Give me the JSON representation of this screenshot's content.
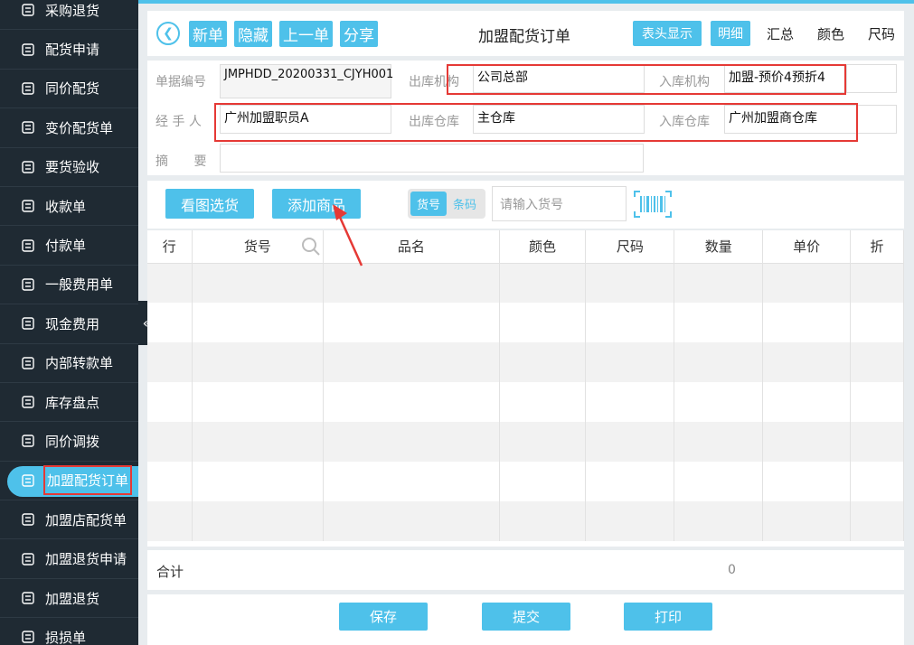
{
  "sidebar": {
    "items": [
      {
        "label": "采购退货",
        "icon": "return-box-icon"
      },
      {
        "label": "配货申请",
        "icon": "gear-house-icon"
      },
      {
        "label": "同价配货",
        "icon": "list-icon"
      },
      {
        "label": "变价配货单",
        "icon": "clipboard-icon"
      },
      {
        "label": "要货验收",
        "icon": "magnify-check-icon"
      },
      {
        "label": "收款单",
        "icon": "yen-box-icon"
      },
      {
        "label": "付款单",
        "icon": "pay-icon"
      },
      {
        "label": "一般费用单",
        "icon": "yen-circle-icon"
      },
      {
        "label": "现金费用",
        "icon": "money-bag-icon"
      },
      {
        "label": "内部转款单",
        "icon": "transfer-icon"
      },
      {
        "label": "库存盘点",
        "icon": "cycle-icon"
      },
      {
        "label": "同价调拨",
        "icon": "cart-icon"
      },
      {
        "label": "加盟配货订单",
        "icon": "order-doc-icon",
        "active": true
      },
      {
        "label": "加盟店配货单",
        "icon": "doc-list-icon"
      },
      {
        "label": "加盟退货申请",
        "icon": "doc-return-icon"
      },
      {
        "label": "加盟退货",
        "icon": "home-return-icon"
      },
      {
        "label": "损损单",
        "icon": "damage-icon"
      }
    ]
  },
  "toolbar": {
    "new_label": "新单",
    "hide_label": "隐藏",
    "prev_label": "上一单",
    "share_label": "分享",
    "title": "加盟配货订单",
    "header_show_label": "表头显示",
    "detail_label": "明细",
    "summary_label": "汇总",
    "color_label": "颜色",
    "size_label": "尺码"
  },
  "form": {
    "doc_no_label": "单据编号",
    "doc_no_value": "JMPHDD_20200331_CJYH001",
    "out_org_label": "出库机构",
    "out_org_value": "公司总部",
    "in_org_label": "入库机构",
    "in_org_value": "加盟-预价4预折4",
    "handler_label": "经 手 人",
    "handler_value": "广州加盟职员A",
    "out_wh_label": "出库仓库",
    "out_wh_value": "主仓库",
    "in_wh_label": "入库仓库",
    "in_wh_value": "广州加盟商仓库",
    "memo_label": "摘 要",
    "memo_value": ""
  },
  "actions": {
    "pick_by_image_label": "看图选货",
    "add_product_label": "添加商品",
    "seg_code_label": "货号",
    "seg_barcode_label": "条码",
    "search_placeholder": "请输入货号"
  },
  "table": {
    "columns": [
      "行",
      "货号",
      "品名",
      "颜色",
      "尺码",
      "数量",
      "单价",
      "折"
    ]
  },
  "totals": {
    "label": "合计",
    "qty": "0"
  },
  "footer": {
    "save_label": "保存",
    "submit_label": "提交",
    "print_label": "打印"
  },
  "colors": {
    "accent": "#4ec1ea",
    "sidebar_bg": "#1f2a33",
    "highlight": "#e53935"
  }
}
